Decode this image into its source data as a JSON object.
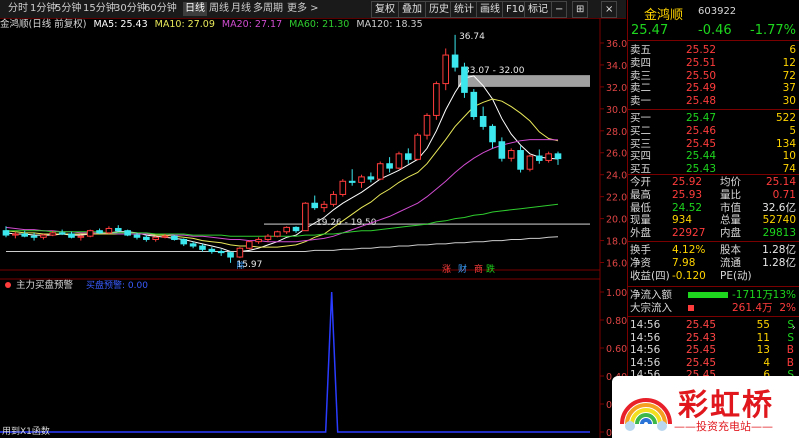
{
  "toolbar": {
    "periods": [
      "分时",
      "1分钟",
      "5分钟",
      "15分钟",
      "30分钟",
      "60分钟",
      "日线",
      "周线",
      "月线",
      "多周期",
      "更多 >"
    ],
    "active_period": "日线",
    "buttons": [
      "复权",
      "叠加",
      "历史",
      "统计",
      "画线",
      "F10",
      "标记",
      "−",
      "⊞"
    ],
    "close": "×"
  },
  "chart_header": {
    "title": "金鸿顺(日线 前复权)",
    "ma5": "MA5: 25.43",
    "ma10": "MA10: 27.09",
    "ma20": "MA20: 27.17",
    "ma60": "MA60: 21.30",
    "ma120": "MA120: 18.35",
    "colors": {
      "ma5": "#ffffff",
      "ma10": "#e8e85a",
      "ma20": "#d04cd0",
      "ma60": "#2ecc2e",
      "ma120": "#cccccc"
    }
  },
  "price_axis": [
    "36.00",
    "34.00",
    "32.00",
    "30.00",
    "28.00",
    "26.00",
    "24.00",
    "22.00",
    "20.00",
    "18.00",
    "16.00"
  ],
  "annotations": {
    "high": "36.74",
    "zone_top": "33.07 - 32.00",
    "zone_bottom": "19.26 - 19.50",
    "low": "15.97",
    "markers": [
      "涨",
      "财",
      "商",
      "跌"
    ]
  },
  "indicator": {
    "title": "主力买盘预警",
    "param": "买盘预警: 0.00",
    "axis": [
      "1.00",
      "0.80",
      "0.60",
      "0.40",
      "0.20",
      "0.00"
    ],
    "footer": "用到X1函数"
  },
  "chart_data": {
    "type": "candlestick",
    "title": "金鸿顺(日线 前复权)",
    "ylim": [
      15.0,
      37.0
    ],
    "candles": [
      [
        18.9,
        19.3,
        18.3,
        18.5
      ],
      [
        18.5,
        18.8,
        18.2,
        18.6
      ],
      [
        18.6,
        18.9,
        18.3,
        18.4
      ],
      [
        18.4,
        18.7,
        18.0,
        18.3
      ],
      [
        18.3,
        18.6,
        18.1,
        18.5
      ],
      [
        18.5,
        18.9,
        18.4,
        18.7
      ],
      [
        18.7,
        19.0,
        18.5,
        18.6
      ],
      [
        18.6,
        18.8,
        18.2,
        18.3
      ],
      [
        18.3,
        18.5,
        18.0,
        18.4
      ],
      [
        18.4,
        19.0,
        18.3,
        18.9
      ],
      [
        18.9,
        19.1,
        18.6,
        18.7
      ],
      [
        18.7,
        19.3,
        18.6,
        19.1
      ],
      [
        19.1,
        19.4,
        18.8,
        18.9
      ],
      [
        18.9,
        19.0,
        18.4,
        18.5
      ],
      [
        18.5,
        18.7,
        18.1,
        18.3
      ],
      [
        18.3,
        18.5,
        17.9,
        18.1
      ],
      [
        18.1,
        18.4,
        17.9,
        18.3
      ],
      [
        18.3,
        18.6,
        18.2,
        18.4
      ],
      [
        18.4,
        18.5,
        18.0,
        18.1
      ],
      [
        18.1,
        18.2,
        17.5,
        17.7
      ],
      [
        17.7,
        17.9,
        17.3,
        17.5
      ],
      [
        17.5,
        17.7,
        17.0,
        17.2
      ],
      [
        17.2,
        17.4,
        16.8,
        17.0
      ],
      [
        17.0,
        17.2,
        16.6,
        16.9
      ],
      [
        16.9,
        17.0,
        15.97,
        16.5
      ],
      [
        16.5,
        17.4,
        16.4,
        17.3
      ],
      [
        17.3,
        18.0,
        17.2,
        17.9
      ],
      [
        17.9,
        18.3,
        17.7,
        18.1
      ],
      [
        18.1,
        18.6,
        17.9,
        18.4
      ],
      [
        18.4,
        18.9,
        18.3,
        18.8
      ],
      [
        18.8,
        19.3,
        18.6,
        19.2
      ],
      [
        19.2,
        19.3,
        18.7,
        18.9
      ],
      [
        18.9,
        21.5,
        18.9,
        21.4
      ],
      [
        21.4,
        22.1,
        20.8,
        21.0
      ],
      [
        21.0,
        21.6,
        20.6,
        21.3
      ],
      [
        21.3,
        22.5,
        21.1,
        22.2
      ],
      [
        22.2,
        23.6,
        22.0,
        23.4
      ],
      [
        23.4,
        24.5,
        23.0,
        23.3
      ],
      [
        23.3,
        24.0,
        22.8,
        23.8
      ],
      [
        23.8,
        24.2,
        23.3,
        23.6
      ],
      [
        23.6,
        25.2,
        23.5,
        25.0
      ],
      [
        25.0,
        25.6,
        24.2,
        24.6
      ],
      [
        24.6,
        26.1,
        24.5,
        25.9
      ],
      [
        25.9,
        26.4,
        25.0,
        25.4
      ],
      [
        25.4,
        27.8,
        25.3,
        27.6
      ],
      [
        27.6,
        29.6,
        27.2,
        29.4
      ],
      [
        29.4,
        32.5,
        29.0,
        32.3
      ],
      [
        32.3,
        35.5,
        31.7,
        34.9
      ],
      [
        34.9,
        36.74,
        33.4,
        33.8
      ],
      [
        33.8,
        34.2,
        31.0,
        31.5
      ],
      [
        31.5,
        31.8,
        29.0,
        29.3
      ],
      [
        29.3,
        30.2,
        28.1,
        28.4
      ],
      [
        28.4,
        28.6,
        26.4,
        27.0
      ],
      [
        27.0,
        27.4,
        25.2,
        25.5
      ],
      [
        25.5,
        26.4,
        25.2,
        26.2
      ],
      [
        26.2,
        26.6,
        24.2,
        24.5
      ],
      [
        24.5,
        25.8,
        24.3,
        25.7
      ],
      [
        25.7,
        26.3,
        25.0,
        25.3
      ],
      [
        25.3,
        26.1,
        25.1,
        25.9
      ],
      [
        25.9,
        26.1,
        24.9,
        25.47
      ]
    ],
    "ma": {
      "ma5": [
        18.7,
        18.6,
        18.6,
        18.5,
        18.5,
        18.5,
        18.6,
        18.5,
        18.5,
        18.6,
        18.6,
        18.7,
        18.8,
        18.8,
        18.7,
        18.5,
        18.4,
        18.3,
        18.2,
        18.1,
        17.9,
        17.7,
        17.5,
        17.3,
        17.0,
        17.0,
        17.1,
        17.3,
        17.6,
        17.9,
        18.3,
        18.5,
        19.1,
        19.6,
        20.1,
        20.8,
        21.4,
        21.9,
        22.4,
        23.0,
        23.6,
        24.0,
        24.4,
        24.9,
        25.4,
        26.4,
        28.0,
        29.9,
        31.5,
        32.8,
        33.0,
        32.1,
        30.9,
        29.1,
        27.7,
        26.7,
        25.9,
        25.6,
        25.5,
        25.43
      ],
      "ma10": [
        18.9,
        18.8,
        18.7,
        18.7,
        18.6,
        18.6,
        18.6,
        18.6,
        18.6,
        18.6,
        18.6,
        18.6,
        18.6,
        18.6,
        18.6,
        18.6,
        18.5,
        18.5,
        18.4,
        18.3,
        18.2,
        18.0,
        17.9,
        17.8,
        17.6,
        17.5,
        17.5,
        17.4,
        17.4,
        17.4,
        17.5,
        17.6,
        17.9,
        18.3,
        18.6,
        19.2,
        19.8,
        20.4,
        21.0,
        21.5,
        22.2,
        22.7,
        23.3,
        23.8,
        24.2,
        25.0,
        26.1,
        27.2,
        28.4,
        29.3,
        30.2,
        30.6,
        30.9,
        30.7,
        30.2,
        29.6,
        28.9,
        27.9,
        27.3,
        27.09
      ],
      "ma20": [
        19.2,
        19.1,
        19.0,
        19.0,
        18.9,
        18.9,
        18.8,
        18.8,
        18.7,
        18.7,
        18.7,
        18.7,
        18.6,
        18.6,
        18.6,
        18.6,
        18.6,
        18.6,
        18.5,
        18.5,
        18.4,
        18.4,
        18.3,
        18.2,
        18.1,
        18.1,
        18.0,
        18.0,
        17.9,
        17.9,
        17.9,
        17.9,
        18.0,
        18.1,
        18.2,
        18.4,
        18.7,
        19.0,
        19.3,
        19.6,
        19.9,
        20.2,
        20.6,
        21.0,
        21.4,
        22.0,
        22.7,
        23.4,
        24.2,
        24.9,
        25.5,
        26.0,
        26.4,
        26.7,
        26.9,
        27.1,
        27.2,
        27.2,
        27.2,
        27.17
      ],
      "ma60": [
        18.9,
        18.9,
        18.9,
        18.9,
        18.9,
        18.8,
        18.8,
        18.8,
        18.8,
        18.8,
        18.8,
        18.7,
        18.7,
        18.7,
        18.7,
        18.7,
        18.6,
        18.6,
        18.6,
        18.6,
        18.5,
        18.5,
        18.5,
        18.5,
        18.4,
        18.4,
        18.4,
        18.4,
        18.4,
        18.4,
        18.4,
        18.4,
        18.5,
        18.5,
        18.6,
        18.6,
        18.7,
        18.8,
        18.9,
        18.9,
        19.0,
        19.1,
        19.2,
        19.3,
        19.4,
        19.5,
        19.7,
        19.8,
        20.0,
        20.1,
        20.3,
        20.4,
        20.6,
        20.7,
        20.8,
        20.9,
        21.0,
        21.1,
        21.2,
        21.3
      ],
      "ma120": [
        17.0,
        17.0,
        17.0,
        17.0,
        17.0,
        17.0,
        17.0,
        17.0,
        17.0,
        17.0,
        17.0,
        17.0,
        17.0,
        17.0,
        17.0,
        17.0,
        17.0,
        17.0,
        17.0,
        17.0,
        17.0,
        17.0,
        17.0,
        17.0,
        17.0,
        17.0,
        17.0,
        17.0,
        17.0,
        17.0,
        17.0,
        17.0,
        17.0,
        17.1,
        17.1,
        17.1,
        17.2,
        17.2,
        17.3,
        17.3,
        17.4,
        17.4,
        17.5,
        17.5,
        17.6,
        17.6,
        17.7,
        17.7,
        17.8,
        17.8,
        17.9,
        17.9,
        18.0,
        18.0,
        18.1,
        18.1,
        18.2,
        18.2,
        18.3,
        18.35
      ]
    },
    "indicator_values": [
      0,
      0,
      0,
      0,
      0,
      0,
      0,
      0,
      0,
      0,
      0,
      0,
      0,
      0,
      0,
      0,
      0,
      0,
      0,
      0,
      0,
      0,
      0,
      0,
      0,
      0,
      0,
      0,
      0,
      0,
      0,
      0,
      0,
      0,
      0,
      0,
      0,
      0,
      0,
      0,
      0,
      0,
      0,
      0,
      0,
      0,
      0,
      0,
      0,
      0,
      0,
      0,
      0,
      0,
      0,
      0,
      0,
      0,
      0,
      0
    ],
    "indicator_spike": {
      "index": 30,
      "value": 1.0
    }
  },
  "quote": {
    "name": "金鸿顺",
    "code": "603922",
    "price": "25.47",
    "change": "-0.46",
    "pct": "-1.77%",
    "asks": [
      {
        "label": "卖五",
        "price": "25.52",
        "vol": "6"
      },
      {
        "label": "卖四",
        "price": "25.51",
        "vol": "12"
      },
      {
        "label": "卖三",
        "price": "25.50",
        "vol": "72"
      },
      {
        "label": "卖二",
        "price": "25.49",
        "vol": "37"
      },
      {
        "label": "卖一",
        "price": "25.48",
        "vol": "30"
      }
    ],
    "bids": [
      {
        "label": "买一",
        "price": "25.47",
        "vol": "522"
      },
      {
        "label": "买二",
        "price": "25.46",
        "vol": "5"
      },
      {
        "label": "买三",
        "price": "25.45",
        "vol": "134"
      },
      {
        "label": "买四",
        "price": "25.44",
        "vol": "10"
      },
      {
        "label": "买五",
        "price": "25.43",
        "vol": "74"
      }
    ],
    "stats": [
      {
        "l1": "今开",
        "v1": "25.92",
        "l2": "均价",
        "v2": "25.14"
      },
      {
        "l1": "最高",
        "v1": "25.93",
        "l2": "量比",
        "v2": "0.71"
      },
      {
        "l1": "最低",
        "v1": "24.52",
        "l2": "市值",
        "v2": "32.6亿"
      },
      {
        "l1": "现量",
        "v1": "934",
        "l2": "总量",
        "v2": "52740"
      },
      {
        "l1": "外盘",
        "v1": "22927",
        "l2": "内盘",
        "v2": "29813"
      }
    ],
    "stats2": [
      {
        "l1": "换手",
        "v1": "4.12%",
        "l2": "股本",
        "v2": "1.28亿"
      },
      {
        "l1": "净资",
        "v1": "7.98",
        "l2": "流通",
        "v2": "1.28亿"
      },
      {
        "l1": "收益(四)",
        "v1": "-0.120",
        "l2": "PE(动)",
        "v2": ""
      }
    ],
    "flows": [
      {
        "label": "净流入额",
        "value": "-1711万",
        "pct": "-13%"
      },
      {
        "label": "大宗流入",
        "value": "261.4万",
        "pct": "2%"
      }
    ],
    "ticks": [
      {
        "time": "14:56",
        "price": "25.45",
        "vol": "55",
        "side": "S"
      },
      {
        "time": "14:56",
        "price": "25.43",
        "vol": "11",
        "side": "S"
      },
      {
        "time": "14:56",
        "price": "25.45",
        "vol": "13",
        "side": "B"
      },
      {
        "time": "14:56",
        "price": "25.45",
        "vol": "4",
        "side": "B"
      },
      {
        "time": "14:56",
        "price": "25.45",
        "vol": "6",
        "side": "S"
      }
    ]
  },
  "watermark": {
    "text": "彩虹桥",
    "subtitle": "——投资充电站——"
  }
}
